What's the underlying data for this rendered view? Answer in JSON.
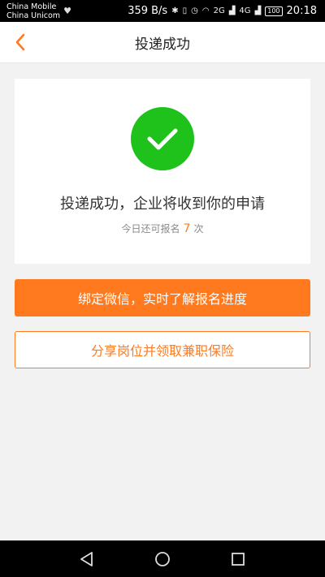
{
  "status_bar": {
    "carrier1": "China Mobile",
    "carrier2": "China Unicom",
    "speed": "359 B/s",
    "network1": "2G",
    "network2": "4G",
    "battery": "100",
    "time": "20:18"
  },
  "header": {
    "title": "投递成功"
  },
  "card": {
    "message": "投递成功，企业将收到你的申请",
    "sub_prefix": "今日还可报名",
    "sub_count": "7",
    "sub_suffix": "次"
  },
  "buttons": {
    "bind_wechat": "绑定微信，实时了解报名进度",
    "share": "分享岗位并领取兼职保险"
  },
  "colors": {
    "accent": "#ff7a1f",
    "success": "#1ec21a",
    "background": "#f2f2f2"
  },
  "icons": {
    "back": "chevron-left-icon",
    "success": "check-circle-icon",
    "nav_back": "triangle-back-icon",
    "nav_home": "circle-home-icon",
    "nav_recent": "square-recent-icon"
  }
}
